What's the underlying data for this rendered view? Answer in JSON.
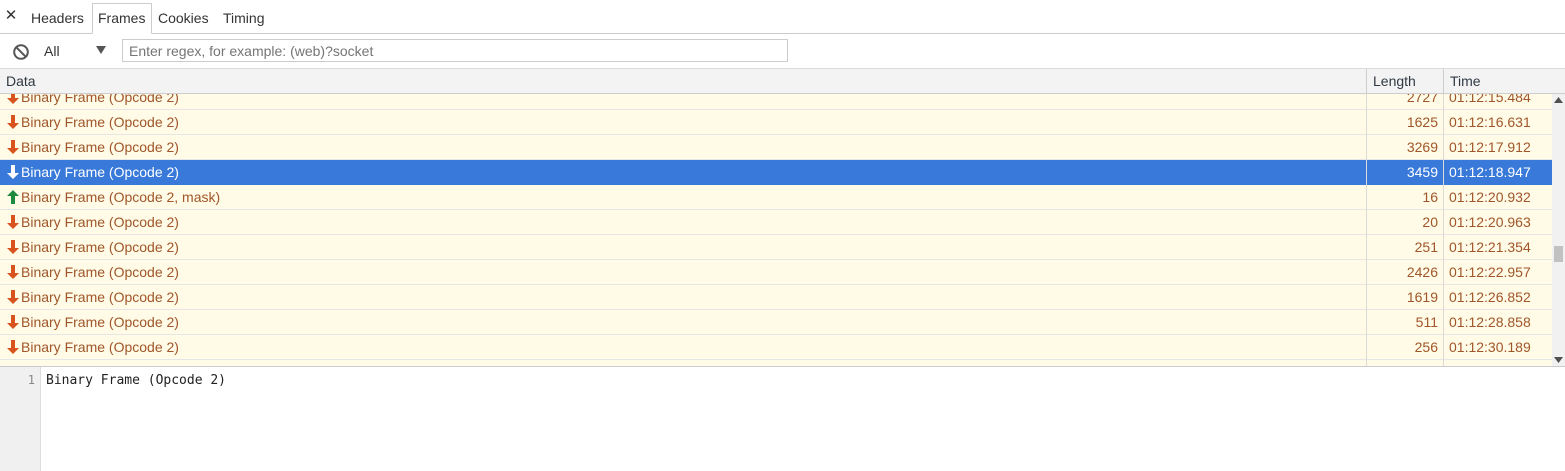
{
  "tabs": [
    {
      "label": "Headers"
    },
    {
      "label": "Frames",
      "selected": true
    },
    {
      "label": "Cookies"
    },
    {
      "label": "Timing"
    }
  ],
  "filter": {
    "type_value": "All",
    "placeholder": "Enter regex, for example: (web)?socket"
  },
  "grid": {
    "columns": {
      "data": "Data",
      "length": "Length",
      "time": "Time"
    },
    "rows": [
      {
        "direction": "received",
        "data": "Binary Frame (Opcode 2)",
        "length": "2727",
        "time": "01:12:15.484"
      },
      {
        "direction": "received",
        "data": "Binary Frame (Opcode 2)",
        "length": "1625",
        "time": "01:12:16.631"
      },
      {
        "direction": "received",
        "data": "Binary Frame (Opcode 2)",
        "length": "3269",
        "time": "01:12:17.912"
      },
      {
        "direction": "received",
        "data": "Binary Frame (Opcode 2)",
        "length": "3459",
        "time": "01:12:18.947",
        "selected": true
      },
      {
        "direction": "sent",
        "data": "Binary Frame (Opcode 2, mask)",
        "length": "16",
        "time": "01:12:20.932"
      },
      {
        "direction": "received",
        "data": "Binary Frame (Opcode 2)",
        "length": "20",
        "time": "01:12:20.963"
      },
      {
        "direction": "received",
        "data": "Binary Frame (Opcode 2)",
        "length": "251",
        "time": "01:12:21.354"
      },
      {
        "direction": "received",
        "data": "Binary Frame (Opcode 2)",
        "length": "2426",
        "time": "01:12:22.957"
      },
      {
        "direction": "received",
        "data": "Binary Frame (Opcode 2)",
        "length": "1619",
        "time": "01:12:26.852"
      },
      {
        "direction": "received",
        "data": "Binary Frame (Opcode 2)",
        "length": "511",
        "time": "01:12:28.858"
      },
      {
        "direction": "received",
        "data": "Binary Frame (Opcode 2)",
        "length": "256",
        "time": "01:12:30.189"
      }
    ]
  },
  "message": {
    "line_number": "1",
    "content": "Binary Frame (Opcode 2)"
  },
  "colors": {
    "received_arrow": "#d9531e",
    "sent_arrow": "#1e8a3c",
    "row_text": "#a0562a",
    "row_background": "#fffbe6",
    "selected_row": "#3879d9"
  },
  "icons": {
    "close": "close-icon",
    "block": "block-icon",
    "dropdown": "chevron-down-icon",
    "received": "arrow-down-icon",
    "sent": "arrow-up-icon"
  }
}
